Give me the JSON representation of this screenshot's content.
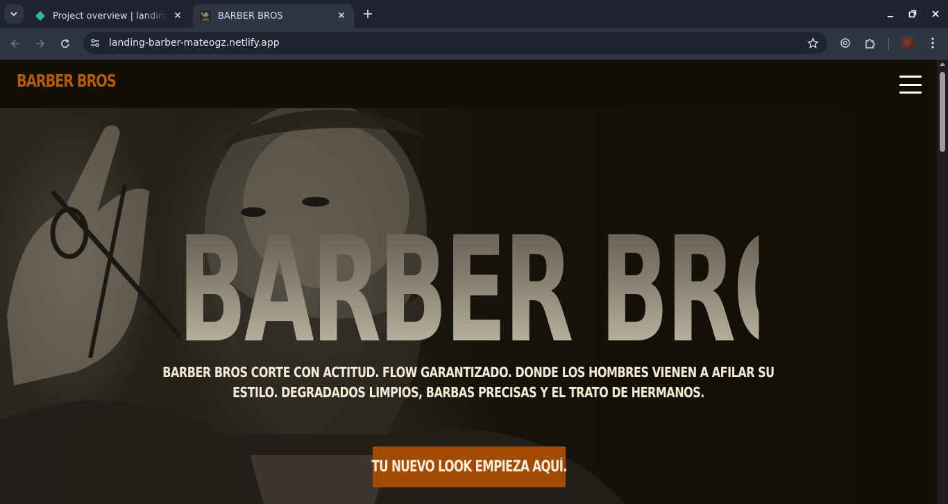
{
  "browser": {
    "tabs": [
      {
        "title": "Project overview | landing-barber",
        "favicon": "netlify-diamond-icon",
        "active": false
      },
      {
        "title": "BARBER BROS",
        "favicon": "barber-photo-icon",
        "active": true
      }
    ],
    "url": "landing-barber-mateogz.netlify.app",
    "colors": {
      "frame": "#1f2430",
      "toolbar": "#2e3545"
    }
  },
  "site": {
    "logo": "BARBER BROS",
    "hero_title": "BARBER BROS",
    "hero_subtitle": "BARBER BROS CORTE CON ACTITUD. FLOW GARANTIZADO. DONDE LOS HOMBRES VIENEN A AFILAR SU ESTILO. DEGRADADOS LIMPIOS, BARBAS PRECISAS Y EL TRATO DE HERMANOS.",
    "cta_label": "TU NUEVO LOOK EMPIEZA AQUÍ.",
    "colors": {
      "accent": "#b35a0f",
      "button": "#a14b06",
      "background": "#120f05",
      "text": "#f3ead7"
    }
  }
}
